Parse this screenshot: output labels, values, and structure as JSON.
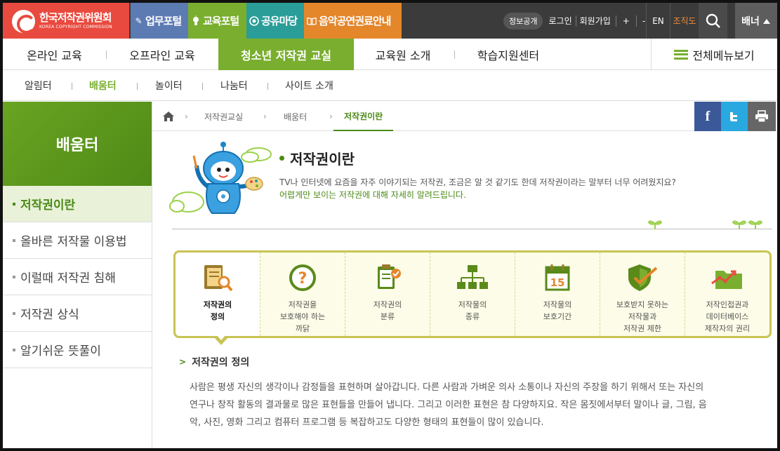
{
  "topbar": {
    "logo_name": "한국저작권위원회",
    "logo_sub": "KOREA COPYRIGHT COMMISSION",
    "tabs": [
      {
        "label": "업무포털",
        "icon": "pen-icon"
      },
      {
        "label": "교육포털",
        "icon": "lightbulb-icon"
      },
      {
        "label": "공유마당",
        "icon": "cc-icon"
      },
      {
        "label": "음악공연권료안내",
        "icon": "book-icon"
      }
    ],
    "info_public": "정보공개",
    "login": "로그인",
    "signup": "회원가입",
    "zoom_in": "+",
    "zoom_out": "-",
    "lang": "EN",
    "org": "조직도",
    "banner": "배너",
    "colors": {
      "logo": "#e94a3f",
      "biz": "#5d7bb3",
      "edu": "#79ae2e",
      "share": "#2a9d98",
      "music": "#e4862a"
    }
  },
  "gnb": {
    "items": [
      "온라인 교육",
      "오프라인 교육",
      "청소년 저작권 교실",
      "교육원 소개",
      "학습지원센터"
    ],
    "active_index": 2,
    "all_menu": "전체메뉴보기"
  },
  "subnav": {
    "items": [
      "알림터",
      "배움터",
      "놀이터",
      "나눔터",
      "사이트 소개"
    ],
    "active_index": 1
  },
  "lnb": {
    "title": "배움터",
    "items": [
      "저작권이란",
      "올바른 저작물 이용법",
      "이럴때 저작권 침해",
      "저작권 상식",
      "알기쉬운 뜻풀이"
    ],
    "active_index": 0
  },
  "breadcrumb": {
    "items": [
      "저작권교실",
      "배움터",
      "저작권이란"
    ]
  },
  "share": {
    "facebook": "f",
    "twitter": "t"
  },
  "intro": {
    "title": "저작권이란",
    "line1": "TV나 인터넷에 요즘을 자주 이야기되는 저작권, 조금은 알 것 같기도 한데 저작권이라는 말부터 너무 어려웠지요?",
    "line2": "어렵게만 보이는 저작권에 대해 자세히 알려드립니다."
  },
  "tabs": [
    {
      "label": "저작권의\n정의",
      "icon": "notebook-search-icon"
    },
    {
      "label": "저작권을\n보호해야 하는\n까닭",
      "icon": "question-icon"
    },
    {
      "label": "저작권의\n분류",
      "icon": "clipboard-check-icon"
    },
    {
      "label": "저작물의\n종류",
      "icon": "org-chart-icon"
    },
    {
      "label": "저작물의\n보호기간",
      "icon": "calendar-icon"
    },
    {
      "label": "보호받지 못하는\n저작물과\n저작권 제한",
      "icon": "shield-check-icon"
    },
    {
      "label": "저작인접권과\n데이터베이스\n제작자의 권리",
      "icon": "folder-chart-icon"
    }
  ],
  "calendar_day": "15",
  "section": {
    "title": "저작권의 정의",
    "lines": [
      "사람은 평생 자신의 생각이나 감정들을 표현하며 살아갑니다. 다른 사람과 가벼운 의사 소통이나 자신의 주장을 하기 위해서 또는 자신의",
      "연구나 창작 활동의 결과물로 많은 표현들을 만들어 냅니다. 그리고 이러한 표현은 참 다양하지요. 작은 몸짓에서부터 말이나 글, 그림, 음",
      "악, 사진, 영화 그리고 컴퓨터 프로그램 등 복잡하고도 다양한 형태의 표현들이 많이 있습니다."
    ]
  }
}
